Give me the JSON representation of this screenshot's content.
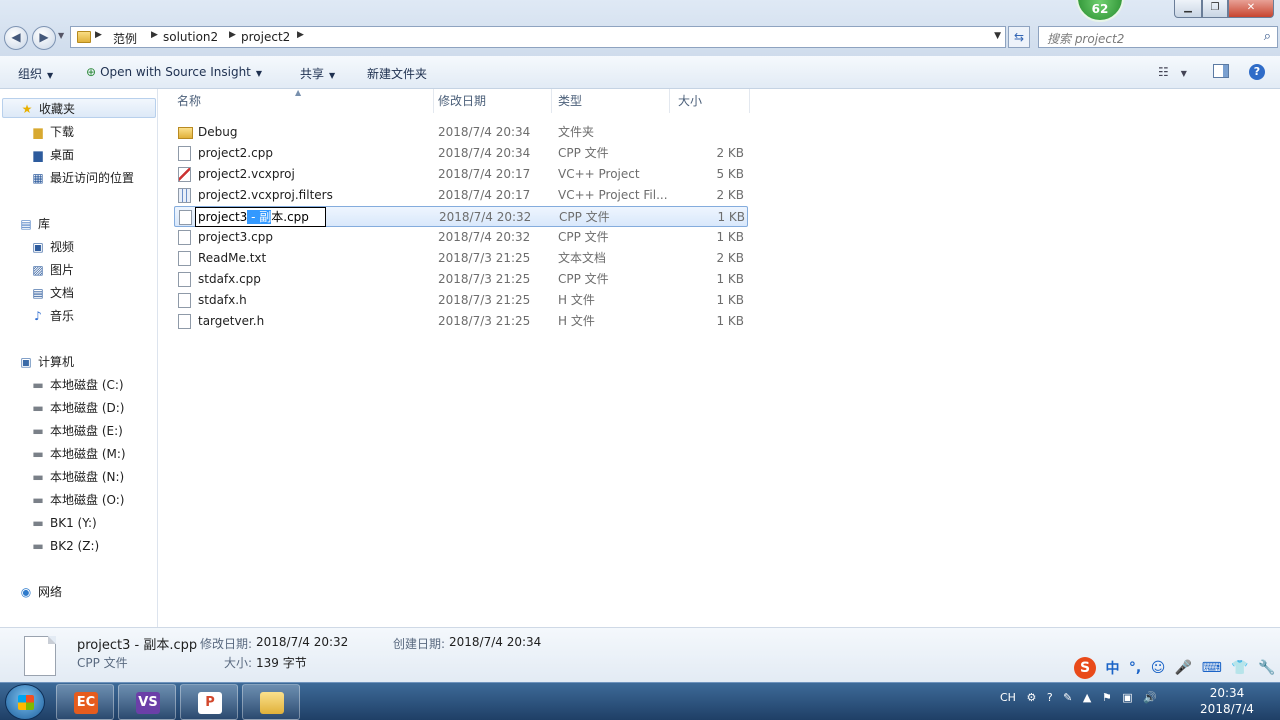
{
  "window": {
    "minimize": "▁",
    "maximize": "❐",
    "close": "✕",
    "badge": "62"
  },
  "address": {
    "crumbs": [
      "范例",
      "solution2",
      "project2"
    ],
    "search_placeholder": "搜索 project2"
  },
  "toolbar": {
    "organize": "组织",
    "open_with": "Open with Source Insight",
    "share": "共享",
    "new_folder": "新建文件夹"
  },
  "sidebar": {
    "favorites": "收藏夹",
    "downloads": "下载",
    "desktop": "桌面",
    "recent": "最近访问的位置",
    "libraries": "库",
    "videos": "视频",
    "pictures": "图片",
    "documents": "文档",
    "music": "音乐",
    "computer": "计算机",
    "drives": [
      "本地磁盘 (C:)",
      "本地磁盘 (D:)",
      "本地磁盘 (E:)",
      "本地磁盘 (M:)",
      "本地磁盘 (N:)",
      "本地磁盘 (O:)",
      "BK1 (Y:)",
      "BK2 (Z:)"
    ],
    "network": "网络"
  },
  "columns": {
    "name": "名称",
    "date": "修改日期",
    "type": "类型",
    "size": "大小"
  },
  "files": [
    {
      "name": "Debug",
      "date": "2018/7/4 20:34",
      "type": "文件夹",
      "size": ""
    },
    {
      "name": "project2.cpp",
      "date": "2018/7/4 20:34",
      "type": "CPP 文件",
      "size": "2 KB"
    },
    {
      "name": "project2.vcxproj",
      "date": "2018/7/4 20:17",
      "type": "VC++ Project",
      "size": "5 KB"
    },
    {
      "name": "project2.vcxproj.filters",
      "date": "2018/7/4 20:17",
      "type": "VC++ Project Fil...",
      "size": "2 KB"
    },
    {
      "name": "project3 - 副本.cpp",
      "date": "2018/7/4 20:32",
      "type": "CPP 文件",
      "size": "1 KB"
    },
    {
      "name": "project3.cpp",
      "date": "2018/7/4 20:32",
      "type": "CPP 文件",
      "size": "1 KB"
    },
    {
      "name": "ReadMe.txt",
      "date": "2018/7/3 21:25",
      "type": "文本文档",
      "size": "2 KB"
    },
    {
      "name": "stdafx.cpp",
      "date": "2018/7/3 21:25",
      "type": "CPP 文件",
      "size": "1 KB"
    },
    {
      "name": "stdafx.h",
      "date": "2018/7/3 21:25",
      "type": "H 文件",
      "size": "1 KB"
    },
    {
      "name": "targetver.h",
      "date": "2018/7/3 21:25",
      "type": "H 文件",
      "size": "1 KB"
    }
  ],
  "rename": {
    "prefix": "project3",
    "selected": " - 副",
    "suffix": "本.cpp"
  },
  "details": {
    "name": "project3 - 副本.cpp",
    "type": "CPP 文件",
    "modified_label": "修改日期:",
    "modified": "2018/7/4 20:32",
    "created_label": "创建日期:",
    "created": "2018/7/4 20:34",
    "size_label": "大小:",
    "size": "139 字节"
  },
  "ime": {
    "logo": "S",
    "mode": "中"
  },
  "taskbar": {
    "lang": "CH",
    "time": "20:34",
    "date": "2018/7/4"
  }
}
